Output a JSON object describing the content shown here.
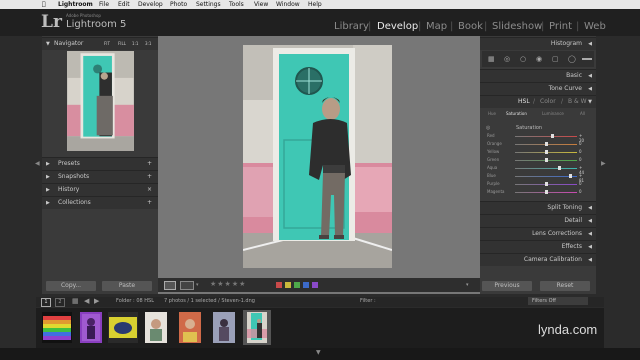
{
  "menubar": {
    "apple": "",
    "items": [
      "Lightroom",
      "File",
      "Edit",
      "Develop",
      "Photo",
      "Settings",
      "Tools",
      "View",
      "Window",
      "Help"
    ]
  },
  "identity": {
    "logo": "Lr",
    "small": "Adobe Photoshop",
    "app_name": "Lightroom 5"
  },
  "modules": [
    "Library",
    "Develop",
    "Map",
    "Book",
    "Slideshow",
    "Print",
    "Web"
  ],
  "active_module": "Develop",
  "left_panel": {
    "navigator": {
      "title": "Navigator",
      "zoom_options": [
        "FIT",
        "FILL",
        "1:1",
        "3:1"
      ]
    },
    "sections": [
      "Presets",
      "Snapshots",
      "History",
      "Collections"
    ],
    "copy_label": "Copy...",
    "paste_label": "Paste"
  },
  "right_panel": {
    "histogram_title": "Histogram",
    "sections_top": [
      "Basic",
      "Tone Curve"
    ],
    "hsl_tabs": [
      "HSL",
      "/",
      "Color",
      "/",
      "B & W"
    ],
    "hsl_subtabs": [
      "Hue",
      "Saturation",
      "Luminance",
      "All"
    ],
    "hsl_group": "Saturation",
    "sliders": [
      {
        "label": "Red",
        "value": "+ 20",
        "fraction": 0.6,
        "color": "#c94a4a"
      },
      {
        "label": "Orange",
        "value": "0",
        "fraction": 0.5,
        "color": "#c97d3c"
      },
      {
        "label": "Yellow",
        "value": "0",
        "fraction": 0.5,
        "color": "#c9b83c"
      },
      {
        "label": "Green",
        "value": "0",
        "fraction": 0.5,
        "color": "#4ea84a"
      },
      {
        "label": "Aqua",
        "value": "+ 44",
        "fraction": 0.72,
        "color": "#3cb8b0"
      },
      {
        "label": "Blue",
        "value": "+ 81",
        "fraction": 0.9,
        "color": "#3c6ac9"
      },
      {
        "label": "Purple",
        "value": "0",
        "fraction": 0.5,
        "color": "#8a4ac9"
      },
      {
        "label": "Magenta",
        "value": "0",
        "fraction": 0.5,
        "color": "#c94ab0"
      }
    ],
    "sections_bottom": [
      "Split Toning",
      "Detail",
      "Lens Corrections",
      "Effects",
      "Camera Calibration"
    ],
    "previous_label": "Previous",
    "reset_label": "Reset"
  },
  "filmbar": {
    "pages": [
      "1",
      "2"
    ],
    "source": "Folder : 08 HSL",
    "info": "7 photos / 1 selected / Steven-1.dng",
    "filter_label": "Filter :",
    "filter_value": "Filters Off"
  },
  "thumbs": [
    {
      "name": "rainbow",
      "selected": false
    },
    {
      "name": "purple-figure",
      "selected": false
    },
    {
      "name": "yellow-car",
      "selected": false
    },
    {
      "name": "portrait-woman",
      "selected": false
    },
    {
      "name": "flowers-portrait",
      "selected": false
    },
    {
      "name": "mural-portrait",
      "selected": false
    },
    {
      "name": "steven-door",
      "selected": true
    }
  ],
  "colors": {
    "accent_door": "#3fc7b4",
    "wall_pink": "#d98a9e",
    "color_labels": [
      "#c94a4a",
      "#c9b83c",
      "#4ea84a",
      "#3c6ac9",
      "#8a4ac9"
    ]
  },
  "watermark": "lynda.com"
}
